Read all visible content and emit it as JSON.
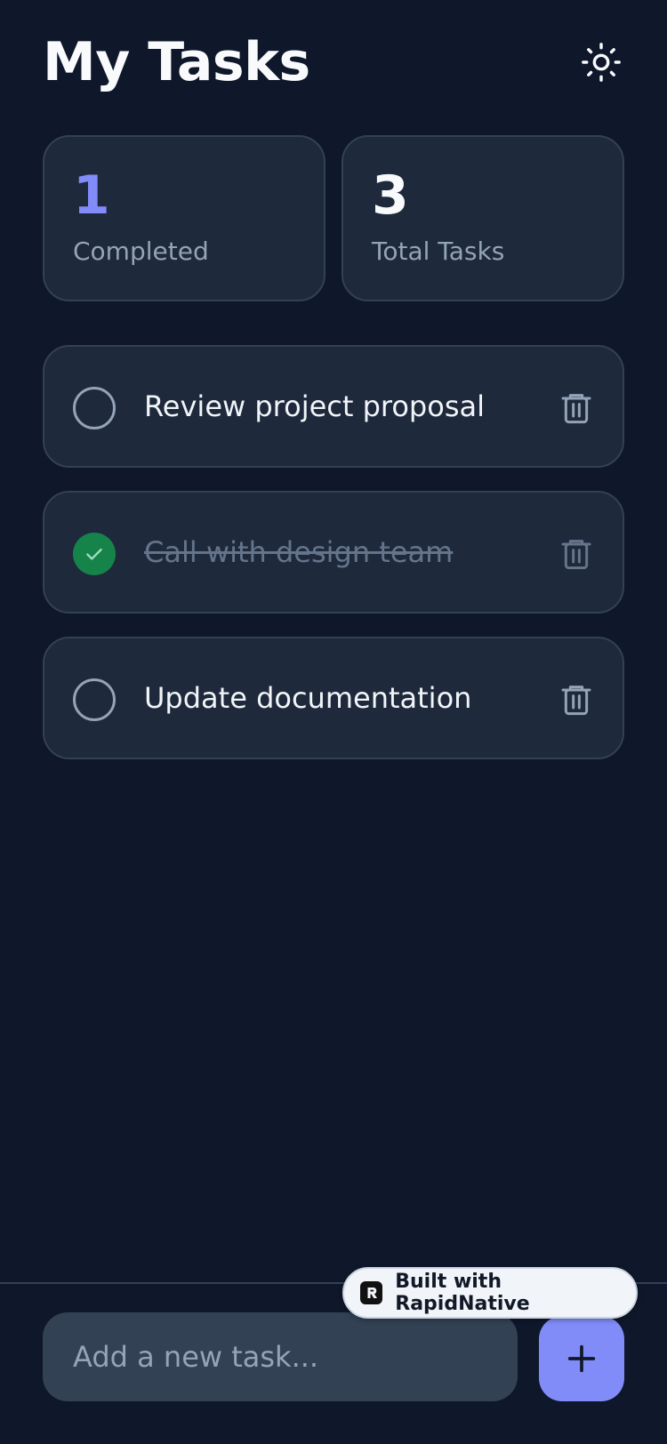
{
  "header": {
    "title": "My Tasks",
    "theme_icon": "sun-icon"
  },
  "stats": {
    "completed": {
      "value": "1",
      "label": "Completed",
      "color": "#818cf8"
    },
    "total": {
      "value": "3",
      "label": "Total Tasks",
      "color": "#f8fafc"
    }
  },
  "tasks": [
    {
      "text": "Review project proposal",
      "completed": false
    },
    {
      "text": "Call with design team",
      "completed": true
    },
    {
      "text": "Update documentation",
      "completed": false
    }
  ],
  "input": {
    "placeholder": "Add a new task...",
    "value": ""
  },
  "add_button": {
    "icon": "plus-icon",
    "color": "#818cf8"
  },
  "badge": {
    "text": "Built with RapidNative"
  },
  "colors": {
    "background": "#0f172a",
    "card": "#1e293b",
    "accent": "#818cf8",
    "done": "#16834a"
  }
}
